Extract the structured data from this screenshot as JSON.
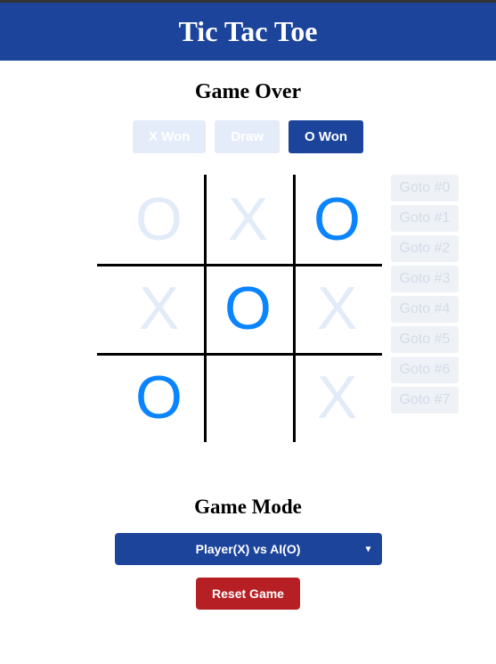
{
  "header": {
    "title": "Tic Tac Toe"
  },
  "status_text": "Game Over",
  "result_buttons": [
    {
      "label": "X Won",
      "active": false
    },
    {
      "label": "Draw",
      "active": false
    },
    {
      "label": "O Won",
      "active": true
    }
  ],
  "board": {
    "cells": [
      {
        "mark": "O",
        "winning": false
      },
      {
        "mark": "X",
        "winning": false
      },
      {
        "mark": "O",
        "winning": true
      },
      {
        "mark": "X",
        "winning": false
      },
      {
        "mark": "O",
        "winning": true
      },
      {
        "mark": "X",
        "winning": false
      },
      {
        "mark": "O",
        "winning": true
      },
      {
        "mark": "",
        "winning": false
      },
      {
        "mark": "X",
        "winning": false
      }
    ]
  },
  "history": [
    {
      "label": "Goto #0"
    },
    {
      "label": "Goto #1"
    },
    {
      "label": "Goto #2"
    },
    {
      "label": "Goto #3"
    },
    {
      "label": "Goto #4"
    },
    {
      "label": "Goto #5"
    },
    {
      "label": "Goto #6"
    },
    {
      "label": "Goto #7"
    }
  ],
  "mode": {
    "heading": "Game Mode",
    "selected": "Player(X) vs AI(O)"
  },
  "reset_label": "Reset Game",
  "colors": {
    "primary": "#1c449b",
    "danger": "#b62025",
    "winning": "#0a84ff",
    "faded": "#e2ecf9"
  }
}
